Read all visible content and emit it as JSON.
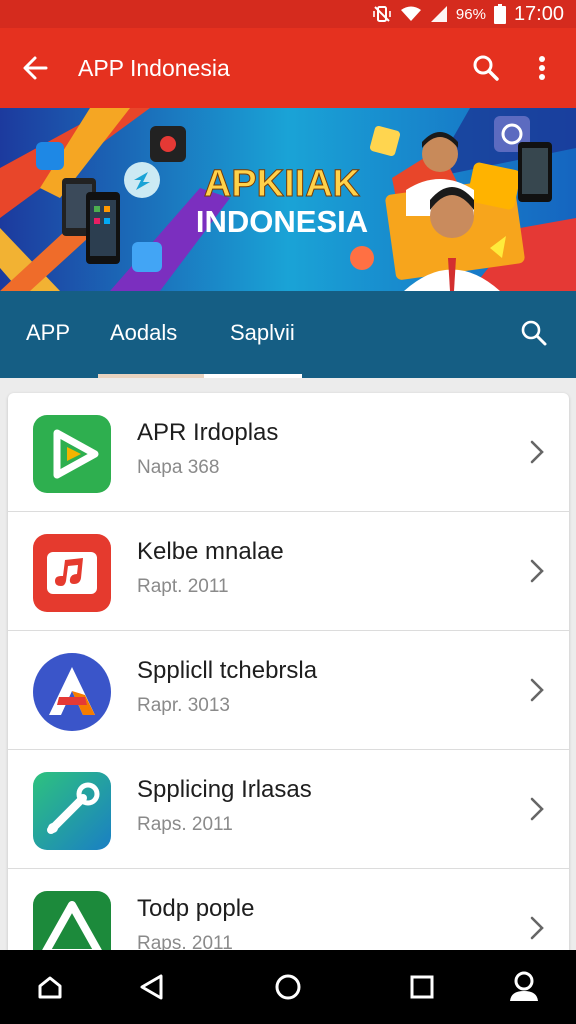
{
  "status_bar": {
    "battery": "96%",
    "time": "17:00"
  },
  "app_bar": {
    "title": "APP Indonesia"
  },
  "banner": {
    "line1": "APKIIAK",
    "line2": "INDONESIA"
  },
  "tabs": [
    {
      "label": "APP"
    },
    {
      "label": "Aodals"
    },
    {
      "label": "Saplvii"
    }
  ],
  "apps": [
    {
      "name": "APR Irdoplas",
      "sub": "Napa 368",
      "icon": "play-triangle-icon",
      "color": "#2eaf4f"
    },
    {
      "name": "Kelbe mnalae",
      "sub": "Rapt. 2011",
      "icon": "music-note-icon",
      "color": "#e53a2e"
    },
    {
      "name": "Spplicll tchebrsla",
      "sub": "Rapr. 3013",
      "icon": "letter-a-icon",
      "color": "#3a55c9"
    },
    {
      "name": "Spplicing Irlasas",
      "sub": "Raps. 2011",
      "icon": "wrench-icon",
      "color": "#1fa88f"
    },
    {
      "name": "Todp pople",
      "sub": "Raps. 2011",
      "icon": "triangle-icon",
      "color": "#1c8a3b"
    }
  ],
  "colors": {
    "status_bar": "#d52b1e",
    "app_bar": "#e5311f",
    "tabs_bar": "#155e84",
    "nav_bar": "#000000"
  }
}
